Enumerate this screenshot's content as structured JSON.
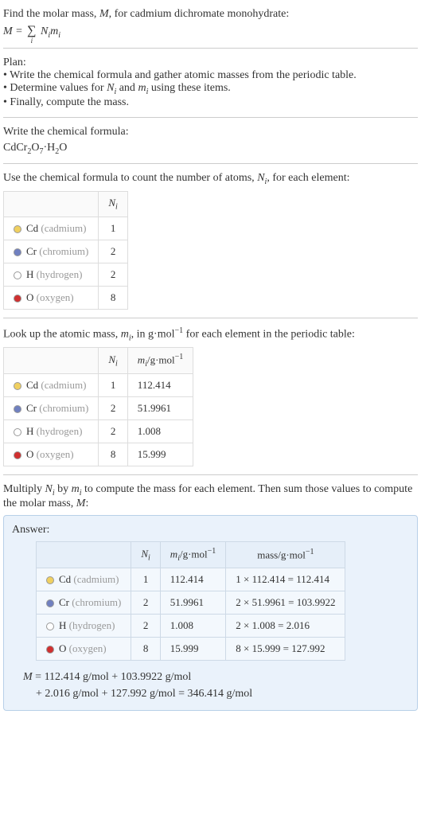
{
  "intro": {
    "line1_prefix": "Find the molar mass, ",
    "line1_m": "M",
    "line1_suffix": ", for cadmium dichromate monohydrate:",
    "eq_m": "M",
    "eq_equals": " = ",
    "eq_sigma": "∑",
    "eq_sigma_sub": "i",
    "eq_rhs_n": "N",
    "eq_rhs_ni": "i",
    "eq_rhs_m": "m",
    "eq_rhs_mi": "i"
  },
  "plan": {
    "heading": "Plan:",
    "items": [
      "Write the chemical formula and gather atomic masses from the periodic table.",
      "Determine values for Nᵢ and mᵢ using these items.",
      "Finally, compute the mass."
    ]
  },
  "plan_items_html": {
    "line2_pre": "Determine values for ",
    "line2_n": "N",
    "line2_ni": "i",
    "line2_and": " and ",
    "line2_m": "m",
    "line2_mi": "i",
    "line2_post": " using these items."
  },
  "write_formula": {
    "heading": "Write the chemical formula:",
    "cd": "CdCr",
    "sub2a": "2",
    "o": "O",
    "sub7": "7",
    "dot": "·H",
    "sub2b": "2",
    "ofinal": "O"
  },
  "count_atoms": {
    "pre": "Use the chemical formula to count the number of atoms, ",
    "n": "N",
    "ni": "i",
    "post": ", for each element:",
    "header_n": "N",
    "header_ni": "i",
    "rows": [
      {
        "color": "#f0d060",
        "sym": "Cd",
        "name": "(cadmium)",
        "n": "1"
      },
      {
        "color": "#7080c0",
        "sym": "Cr",
        "name": "(chromium)",
        "n": "2"
      },
      {
        "color": "#ffffff",
        "sym": "H",
        "name": "(hydrogen)",
        "n": "2"
      },
      {
        "color": "#d03030",
        "sym": "O",
        "name": "(oxygen)",
        "n": "8"
      }
    ]
  },
  "lookup_mass": {
    "pre": "Look up the atomic mass, ",
    "m": "m",
    "mi": "i",
    "mid": ", in g·mol",
    "exp": "−1",
    "post": " for each element in the periodic table:",
    "header_n": "N",
    "header_ni": "i",
    "header_m": "m",
    "header_mi": "i",
    "header_unit_pre": "/g·mol",
    "header_unit_exp": "−1",
    "rows": [
      {
        "color": "#f0d060",
        "sym": "Cd",
        "name": "(cadmium)",
        "n": "1",
        "m": "112.414"
      },
      {
        "color": "#7080c0",
        "sym": "Cr",
        "name": "(chromium)",
        "n": "2",
        "m": "51.9961"
      },
      {
        "color": "#ffffff",
        "sym": "H",
        "name": "(hydrogen)",
        "n": "2",
        "m": "1.008"
      },
      {
        "color": "#d03030",
        "sym": "O",
        "name": "(oxygen)",
        "n": "8",
        "m": "15.999"
      }
    ]
  },
  "multiply": {
    "pre": "Multiply ",
    "n": "N",
    "ni": "i",
    "by": " by ",
    "m": "m",
    "mi": "i",
    "mid": " to compute the mass for each element. Then sum those values to compute the molar mass, ",
    "capm": "M",
    "post": ":"
  },
  "answer": {
    "label": "Answer:",
    "header_n": "N",
    "header_ni": "i",
    "header_m": "m",
    "header_mi": "i",
    "header_munit_pre": "/g·mol",
    "header_munit_exp": "−1",
    "header_mass_pre": "mass/g·mol",
    "header_mass_exp": "−1",
    "rows": [
      {
        "color": "#f0d060",
        "sym": "Cd",
        "name": "(cadmium)",
        "n": "1",
        "m": "112.414",
        "mass": "1 × 112.414 = 112.414"
      },
      {
        "color": "#7080c0",
        "sym": "Cr",
        "name": "(chromium)",
        "n": "2",
        "m": "51.9961",
        "mass": "2 × 51.9961 = 103.9922"
      },
      {
        "color": "#ffffff",
        "sym": "H",
        "name": "(hydrogen)",
        "n": "2",
        "m": "1.008",
        "mass": "2 × 1.008 = 2.016"
      },
      {
        "color": "#d03030",
        "sym": "O",
        "name": "(oxygen)",
        "n": "8",
        "m": "15.999",
        "mass": "8 × 15.999 = 127.992"
      }
    ],
    "final_m": "M",
    "final_line1": " = 112.414 g/mol + 103.9922 g/mol",
    "final_line2": "+ 2.016 g/mol + 127.992 g/mol = 346.414 g/mol"
  },
  "chart_data": {
    "type": "table",
    "title": "Molar mass computation for cadmium dichromate monohydrate",
    "formula": "CdCr2O7·H2O",
    "elements": [
      {
        "element": "Cd",
        "name": "cadmium",
        "N_i": 1,
        "m_i_g_per_mol": 112.414,
        "mass_g_per_mol": 112.414
      },
      {
        "element": "Cr",
        "name": "chromium",
        "N_i": 2,
        "m_i_g_per_mol": 51.9961,
        "mass_g_per_mol": 103.9922
      },
      {
        "element": "H",
        "name": "hydrogen",
        "N_i": 2,
        "m_i_g_per_mol": 1.008,
        "mass_g_per_mol": 2.016
      },
      {
        "element": "O",
        "name": "oxygen",
        "N_i": 8,
        "m_i_g_per_mol": 15.999,
        "mass_g_per_mol": 127.992
      }
    ],
    "molar_mass_g_per_mol": 346.414
  }
}
